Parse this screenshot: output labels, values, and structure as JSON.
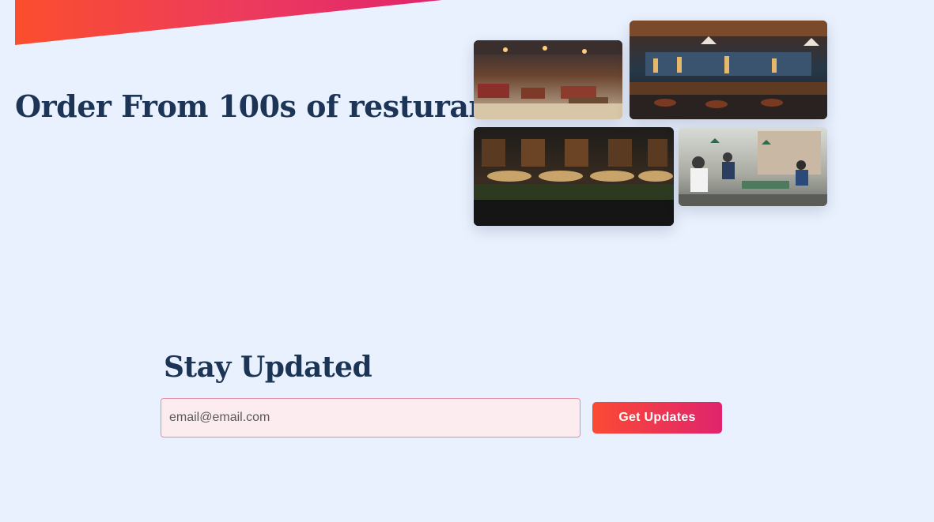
{
  "hero": {
    "title": "Order From 100s of resturants",
    "gallery": [
      {
        "icon": "restaurant-interior-photo"
      },
      {
        "icon": "bar-counter-photo"
      },
      {
        "icon": "outdoor-terrace-photo"
      },
      {
        "icon": "busy-cafe-photo"
      }
    ]
  },
  "subscribe": {
    "title": "Stay Updated",
    "email_placeholder": "email@email.com",
    "email_value": "",
    "button_label": "Get Updates"
  },
  "colors": {
    "background": "#eaf1fe",
    "heading": "#1c3556",
    "accent_start": "#fb4e2e",
    "accent_end": "#e0246d",
    "input_background": "#fdecef"
  }
}
